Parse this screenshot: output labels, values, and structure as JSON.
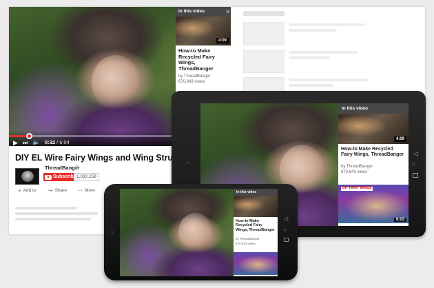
{
  "desktop": {
    "video": {
      "elapsed": "0:32",
      "duration": "6:04",
      "progress_fraction": 0.09
    },
    "card": {
      "header": "In this video",
      "title": "How-to Make Recycled Fairy Wings, ThreadBanger",
      "channel": "by ThreadBanger",
      "views": "670,843 views",
      "duration": "4:09"
    },
    "title": "DIY EL Wire Fairy Wings and Wing Structure Tutorial",
    "channel": "ThreadBanger",
    "subscribe_label": "Subscribe",
    "subscriber_count": "1,032,158",
    "actions": {
      "add_label": "Add to",
      "share_label": "Share",
      "more_label": "More"
    }
  },
  "tablet": {
    "card": {
      "header": "In this video",
      "title": "How-to Make Recycled Fairy Wings, ThreadBanger",
      "channel": "by ThreadBanger",
      "views": "670,843 views",
      "duration": "4:09",
      "next_duration": "6:03",
      "next_tag": "DIY FAIRY WINGS"
    }
  },
  "phone": {
    "card": {
      "header": "In this video",
      "title": "How-to Make Recycled Fairy Wings, ThreadBanger",
      "channel": "by ThreadBanger",
      "views": "670,843 views"
    }
  },
  "colors": {
    "brand_red": "#e52d27",
    "page_bg": "#ececec"
  },
  "icons": [
    "play-icon",
    "next-icon",
    "volume-icon",
    "close-icon",
    "verified-icon",
    "youtube-icon",
    "add-icon",
    "share-icon",
    "more-icon",
    "back-icon",
    "home-icon",
    "recent-apps-icon"
  ]
}
